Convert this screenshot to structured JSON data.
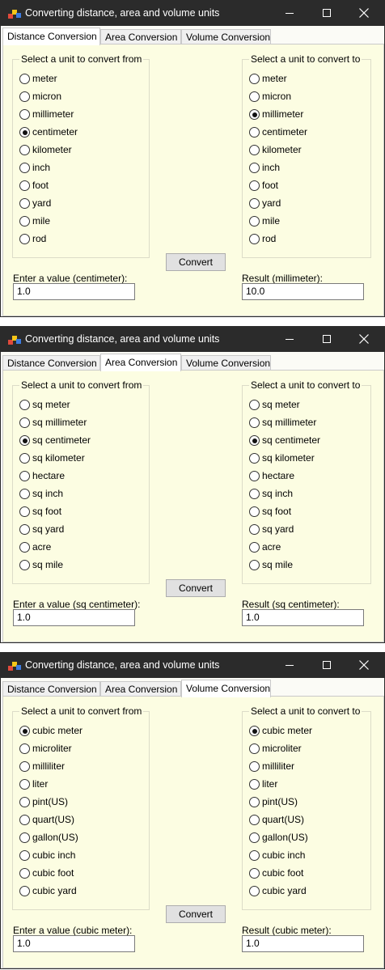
{
  "windows": [
    {
      "title": "Converting distance, area and volume units",
      "tabs": [
        "Distance Conversion",
        "Area Conversion",
        "Volume Conversion"
      ],
      "active_tab": 0,
      "from_group": {
        "title": "Select a unit to convert from",
        "options": [
          "meter",
          "micron",
          "millimeter",
          "centimeter",
          "kilometer",
          "inch",
          "foot",
          "yard",
          "mile",
          "rod"
        ],
        "selected": 3
      },
      "to_group": {
        "title": "Select a unit to convert to",
        "options": [
          "meter",
          "micron",
          "millimeter",
          "centimeter",
          "kilometer",
          "inch",
          "foot",
          "yard",
          "mile",
          "rod"
        ],
        "selected": 2
      },
      "convert_label": "Convert",
      "value_label": "Enter a value (centimeter):",
      "value": "1.0",
      "result_label": "Result (millimeter):",
      "result": "10.0"
    },
    {
      "title": "Converting distance, area and volume units",
      "tabs": [
        "Distance Conversion",
        "Area Conversion",
        "Volume Conversion"
      ],
      "active_tab": 1,
      "from_group": {
        "title": "Select a unit to convert from",
        "options": [
          "sq meter",
          "sq millimeter",
          "sq centimeter",
          "sq kilometer",
          "hectare",
          "sq inch",
          "sq foot",
          "sq yard",
          "acre",
          "sq mile"
        ],
        "selected": 2
      },
      "to_group": {
        "title": "Select a unit to convert to",
        "options": [
          "sq meter",
          "sq millimeter",
          "sq centimeter",
          "sq kilometer",
          "hectare",
          "sq inch",
          "sq foot",
          "sq yard",
          "acre",
          "sq mile"
        ],
        "selected": 2
      },
      "convert_label": "Convert",
      "value_label": "Enter a value (sq centimeter):",
      "value": "1.0",
      "result_label": "Result (sq centimeter):",
      "result": "1.0"
    },
    {
      "title": "Converting distance, area and volume units",
      "tabs": [
        "Distance Conversion",
        "Area Conversion",
        "Volume Conversion"
      ],
      "active_tab": 2,
      "from_group": {
        "title": "Select a unit to convert from",
        "options": [
          "cubic meter",
          "microliter",
          "milliliter",
          "liter",
          "pint(US)",
          "quart(US)",
          "gallon(US)",
          "cubic inch",
          "cubic foot",
          "cubic yard"
        ],
        "selected": 0
      },
      "to_group": {
        "title": "Select a unit to convert to",
        "options": [
          "cubic meter",
          "microliter",
          "milliliter",
          "liter",
          "pint(US)",
          "quart(US)",
          "gallon(US)",
          "cubic inch",
          "cubic foot",
          "cubic yard"
        ],
        "selected": 0
      },
      "convert_label": "Convert",
      "value_label": "Enter a value (cubic meter):",
      "value": "1.0",
      "result_label": "Result (cubic meter):",
      "result": "1.0"
    }
  ]
}
